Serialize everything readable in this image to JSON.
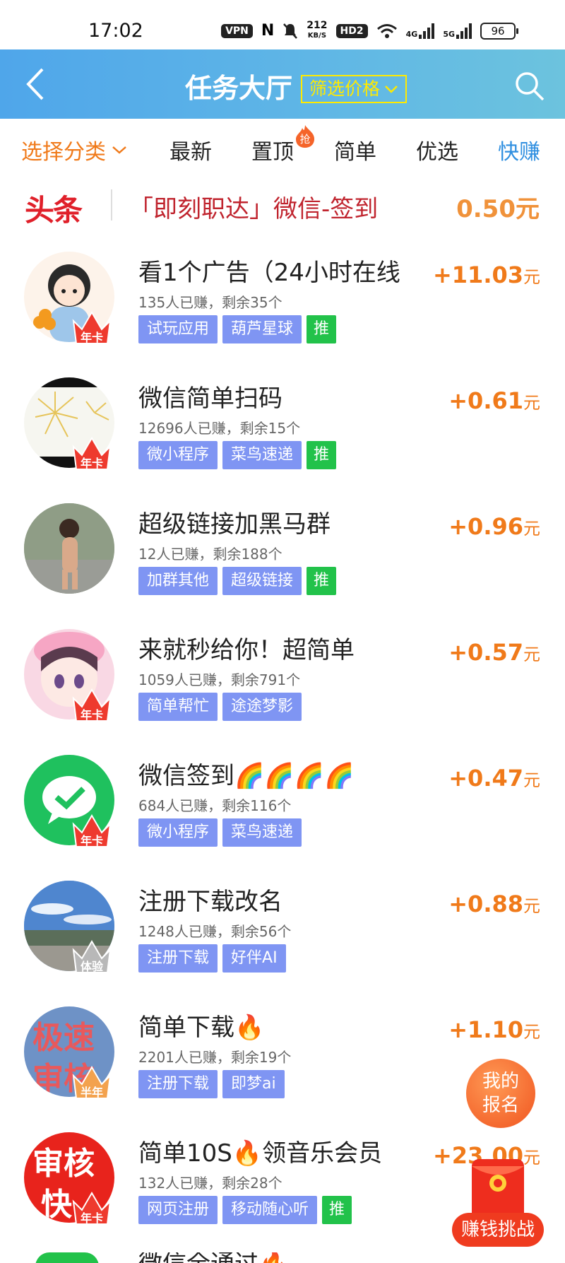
{
  "status_bar": {
    "time": "17:02",
    "vpn": "VPN",
    "speed_value": "212",
    "speed_unit": "KB/S",
    "hd": "HD2",
    "net1": "4G",
    "net2": "5G",
    "battery": "96"
  },
  "header": {
    "title": "任务大厅",
    "filter_label": "筛选价格"
  },
  "tabs": {
    "category": "选择分类",
    "items": [
      "最新",
      "置顶",
      "简单",
      "优选",
      "快赚"
    ],
    "hot_badge": "抢"
  },
  "headline": {
    "logo": "头条",
    "text": "「即刻职达」微信-签到",
    "amount": "0.50元"
  },
  "tasks": [
    {
      "title": "看1个广告（24小时在线",
      "meta": "135人已赚，剩余35个",
      "tags": [
        "试玩应用",
        "葫芦星球"
      ],
      "push": "推",
      "price": "+11.03",
      "unit": "元",
      "crown": "年卡"
    },
    {
      "title": "微信简单扫码",
      "meta": "12696人已赚，剩余15个",
      "tags": [
        "微小程序",
        "菜鸟速递"
      ],
      "push": "推",
      "price": "+0.61",
      "unit": "元",
      "crown": "年卡"
    },
    {
      "title": "超级链接加黑马群",
      "meta": "12人已赚，剩余188个",
      "tags": [
        "加群其他",
        "超级链接"
      ],
      "push": "推",
      "price": "+0.96",
      "unit": "元",
      "crown": ""
    },
    {
      "title": "来就秒给你！超简单",
      "meta": "1059人已赚，剩余791个",
      "tags": [
        "简单帮忙",
        "途途梦影"
      ],
      "price": "+0.57",
      "unit": "元",
      "crown": "年卡"
    },
    {
      "title": "微信签到🌈🌈🌈🌈",
      "meta": "684人已赚，剩余116个",
      "tags": [
        "微小程序",
        "菜鸟速递"
      ],
      "price": "+0.47",
      "unit": "元",
      "crown": "年卡"
    },
    {
      "title": "注册下载改名",
      "meta": "1248人已赚，剩余56个",
      "tags": [
        "注册下载",
        "好伴AI"
      ],
      "price": "+0.88",
      "unit": "元",
      "crown": "体验"
    },
    {
      "title": "简单下载🔥",
      "meta": "2201人已赚，剩余19个",
      "tags": [
        "注册下载",
        "即梦ai"
      ],
      "price": "+1.10",
      "unit": "元",
      "crown": "半年"
    },
    {
      "title": "简单10S🔥领音乐会员",
      "meta": "132人已赚，剩余28个",
      "tags": [
        "网页注册",
        "移动随心听"
      ],
      "push": "推",
      "price": "+23.00",
      "unit": "元",
      "crown": "年卡"
    }
  ],
  "avatar_text": {
    "task7_line1": "极速",
    "task7_line2": "审核",
    "task8_line1": "审核",
    "task8_line2": "快"
  },
  "partial_next": "微信全通过🔥",
  "floating": {
    "my_signup": "我的报名",
    "challenge": "赚钱挑战"
  },
  "colors": {
    "accent_orange": "#f07a1a",
    "header_blue": "#4fa6ea",
    "tag_purple": "#7f95f3",
    "push_green": "#22c24a",
    "headline_red": "#c0242e"
  }
}
